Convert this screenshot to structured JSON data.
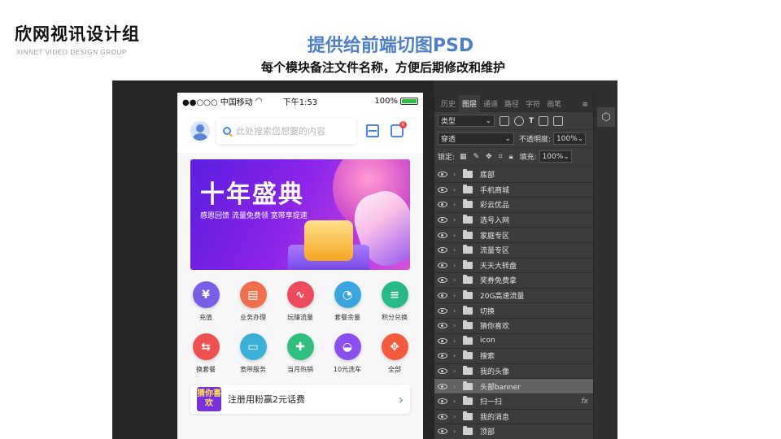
{
  "logo": {
    "main": "欣网视讯设计组",
    "sub": "XINNET VIDEO DESIGN GROUP"
  },
  "title": "提供给前端切图PSD",
  "subtitle": "每个模块备注文件名称，方便后期修改和维护",
  "phone": {
    "status": {
      "carrier": "●●○○○ 中国移动",
      "time": "下午1:53",
      "battery": "100%"
    },
    "search_placeholder": "此处搜索您想要的内容",
    "msg_badge": "6",
    "banner": {
      "title": "十年盛典",
      "subtitle": "感恩回馈 流量免费领 宽带享提速"
    },
    "grid": [
      [
        {
          "label": "充值",
          "icon": "money-bag-icon",
          "glyph": "¥",
          "color": "#7a5de8"
        },
        {
          "label": "业务办理",
          "icon": "document-icon",
          "glyph": "▤",
          "color": "#f0704e"
        },
        {
          "label": "玩赚流量",
          "icon": "pulse-icon",
          "glyph": "∿",
          "color": "#ee4c5e"
        },
        {
          "label": "套餐余量",
          "icon": "pie-chart-icon",
          "glyph": "◔",
          "color": "#3aa6e0"
        },
        {
          "label": "积分兑换",
          "icon": "coins-icon",
          "glyph": "≡",
          "color": "#27b98a"
        }
      ],
      [
        {
          "label": "换套餐",
          "icon": "swap-card-icon",
          "glyph": "⇆",
          "color": "#ee5050"
        },
        {
          "label": "宽带服务",
          "icon": "router-icon",
          "glyph": "▭",
          "color": "#3ab0d8"
        },
        {
          "label": "当月热销",
          "icon": "gift-icon",
          "glyph": "✚",
          "color": "#2fbf7f"
        },
        {
          "label": "10元洗车",
          "icon": "car-icon",
          "glyph": "◒",
          "color": "#8a4ff0"
        },
        {
          "label": "全部",
          "icon": "grid-all-icon",
          "glyph": "✥",
          "color": "#f25b3e"
        }
      ]
    ],
    "promo": {
      "tag": "猜你喜欢",
      "text": "注册用粉赢2元话费"
    }
  },
  "ps": {
    "tabs": [
      "历史",
      "图层",
      "通道",
      "路径",
      "字符",
      "画笔"
    ],
    "active_tab": "图层",
    "kind_label": "类型",
    "blend_mode": "穿透",
    "opacity_label": "不透明度:",
    "opacity_value": "100%",
    "lock_label": "锁定:",
    "fill_label": "填充:",
    "fill_value": "100%",
    "layers": [
      "底部",
      "手机商城",
      "彩云优品",
      "选号入网",
      "家庭专区",
      "流量专区",
      "天天大转盘",
      "奖券免费拿",
      "20G高速流量",
      "切换",
      "猜你喜欢",
      "icon",
      "搜索",
      "我的头像",
      "头部banner",
      "扫一扫",
      "我的消息",
      "顶部"
    ],
    "selected_layer": "头部banner",
    "fx_layer": "扫一扫",
    "fx_label": "fx"
  }
}
